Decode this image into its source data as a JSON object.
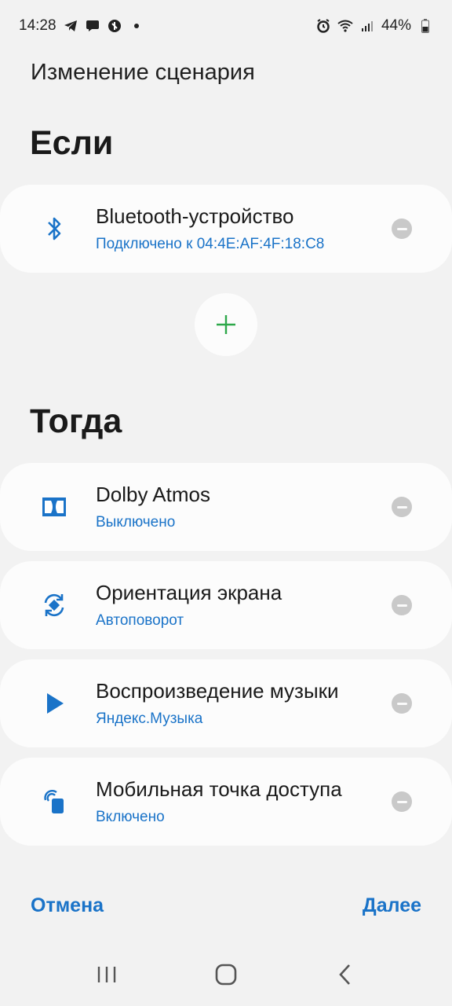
{
  "status_bar": {
    "time": "14:28",
    "battery": "44%",
    "left_icons": [
      "telegram-icon",
      "message-icon",
      "vpn-icon",
      "dot-icon"
    ],
    "right_icons": [
      "alarm-icon",
      "wifi-icon",
      "signal-icon",
      "battery-icon"
    ]
  },
  "header": {
    "title": "Изменение сценария"
  },
  "if_section": {
    "heading": "Если",
    "conditions": [
      {
        "title": "Bluetooth-устройство",
        "subtitle": "Подключено к 04:4E:AF:4F:18:C8",
        "icon": "bluetooth-icon"
      }
    ],
    "add_icon": "plus-icon"
  },
  "then_section": {
    "heading": "Тогда",
    "actions": [
      {
        "title": "Dolby Atmos",
        "subtitle": "Выключено",
        "icon": "dolby-icon"
      },
      {
        "title": "Ориентация экрана",
        "subtitle": "Автоповорот",
        "icon": "auto-rotate-icon"
      },
      {
        "title": "Воспроизведение музыки",
        "subtitle": "Яндекс.Музыка",
        "icon": "play-icon"
      },
      {
        "title": "Мобильная точка доступа",
        "subtitle": "Включено",
        "icon": "hotspot-icon"
      }
    ]
  },
  "footer": {
    "cancel_label": "Отмена",
    "next_label": "Далее"
  },
  "nav_bar": {
    "icons": [
      "recent-apps-icon",
      "home-icon",
      "back-icon"
    ]
  },
  "colors": {
    "accent": "#1a73c8",
    "add_green": "#2ea84a",
    "background": "#f2f2f2",
    "card": "#fcfcfc"
  }
}
